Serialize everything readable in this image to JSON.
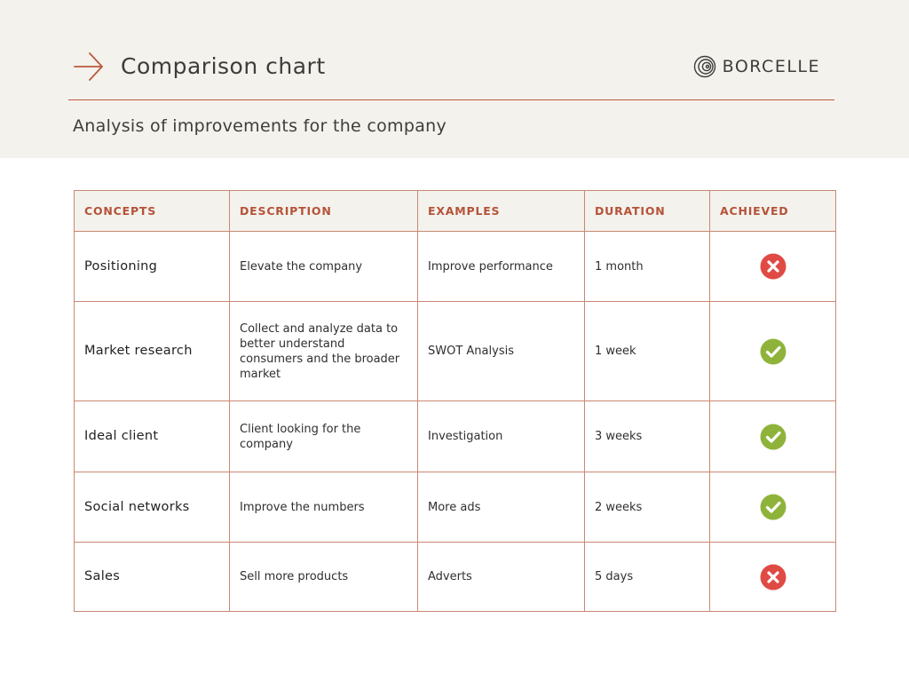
{
  "header": {
    "title": "Comparison chart",
    "brand": "BORCELLE",
    "subtitle": "Analysis of improvements for the company"
  },
  "colors": {
    "band": "#f3f2ed",
    "accent": "#bc5a3d",
    "achieved_yes": "#8fb33a",
    "achieved_no": "#e04a45"
  },
  "table": {
    "columns": [
      "CONCEPTS",
      "DESCRIPTION",
      "EXAMPLES",
      "DURATION",
      "ACHIEVED"
    ],
    "rows": [
      {
        "concept": "Positioning",
        "description": "Elevate the company",
        "example": "Improve performance",
        "duration": "1 month",
        "achieved": false
      },
      {
        "concept": "Market research",
        "description": "Collect and analyze data to better understand consumers and the broader market",
        "example": "SWOT Analysis",
        "duration": "1 week",
        "achieved": true
      },
      {
        "concept": "Ideal client",
        "description": "Client looking for the company",
        "example": "Investigation",
        "duration": "3 weeks",
        "achieved": true
      },
      {
        "concept": "Social networks",
        "description": "Improve the numbers",
        "example": "More ads",
        "duration": "2 weeks",
        "achieved": true
      },
      {
        "concept": "Sales",
        "description": "Sell more products",
        "example": "Adverts",
        "duration": "5 days",
        "achieved": false
      }
    ]
  }
}
